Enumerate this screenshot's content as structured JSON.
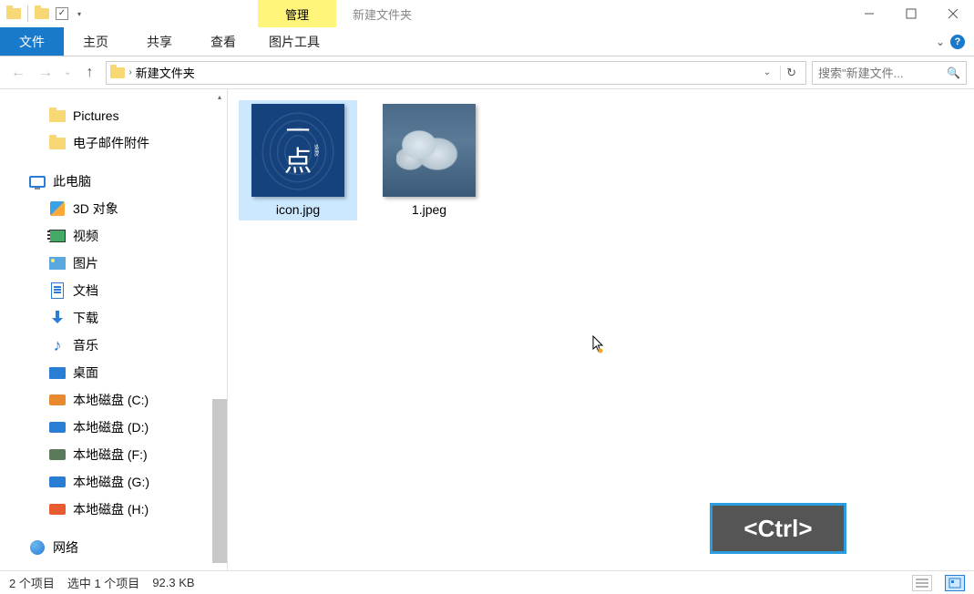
{
  "window": {
    "title": "新建文件夹",
    "manage_label": "管理"
  },
  "ribbon": {
    "file": "文件",
    "home": "主页",
    "share": "共享",
    "view": "查看",
    "imgtools": "图片工具"
  },
  "address": {
    "crumb": "新建文件夹"
  },
  "search": {
    "placeholder": "搜索\"新建文件..."
  },
  "nav": {
    "pictures": "Pictures",
    "attachments": "电子邮件附件",
    "thispc": "此电脑",
    "obj3d": "3D 对象",
    "video": "视频",
    "pics": "图片",
    "docs": "文档",
    "downloads": "下载",
    "music": "音乐",
    "desktop": "桌面",
    "diskC": "本地磁盘 (C:)",
    "diskD": "本地磁盘 (D:)",
    "diskF": "本地磁盘 (F:)",
    "diskG": "本地磁盘 (G:)",
    "diskH": "本地磁盘 (H:)",
    "network": "网络"
  },
  "files": {
    "item1": "icon.jpg",
    "item2": "1.jpeg"
  },
  "status": {
    "count": "2 个项目",
    "selection": "选中 1 个项目",
    "size": "92.3 KB"
  },
  "overlay": {
    "ctrl": "<Ctrl>"
  },
  "thumb_icon": {
    "top_char": "一",
    "bottom_char": "点",
    "side_text": "skills"
  }
}
